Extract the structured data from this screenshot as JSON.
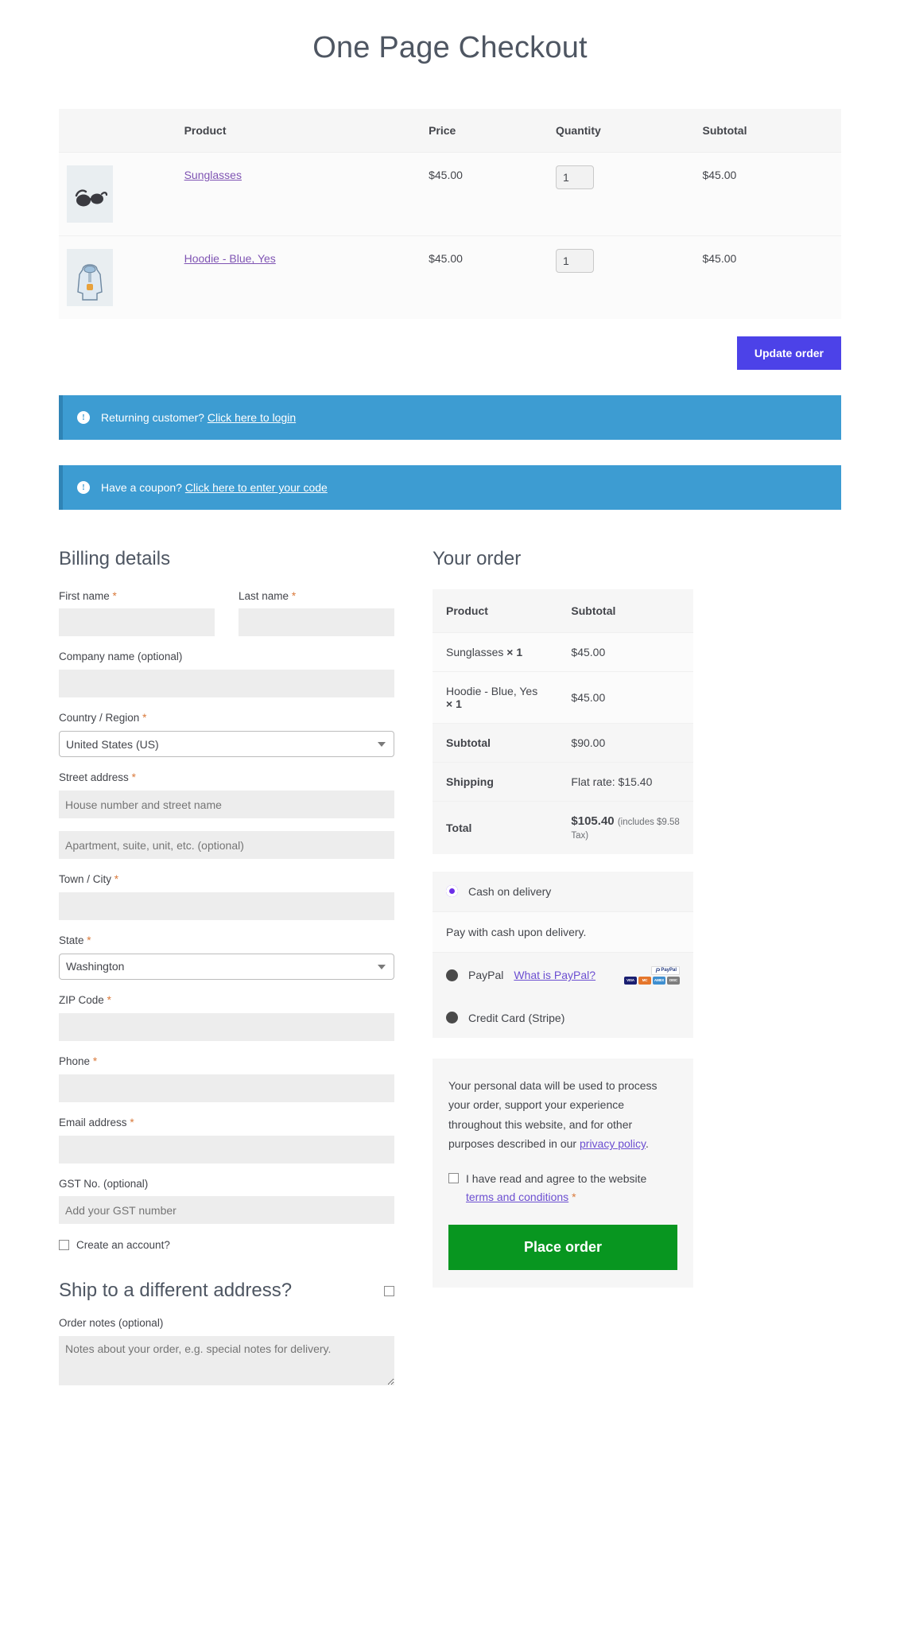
{
  "page": {
    "title": "One Page Checkout"
  },
  "cart": {
    "headers": {
      "thumb": "",
      "product": "Product",
      "price": "Price",
      "quantity": "Quantity",
      "subtotal": "Subtotal"
    },
    "items": [
      {
        "icon": "sunglasses-thumbnail",
        "name": "Sunglasses",
        "price": "$45.00",
        "qty": "1",
        "subtotal": "$45.00"
      },
      {
        "icon": "hoodie-thumbnail",
        "name": "Hoodie - Blue, Yes",
        "price": "$45.00",
        "qty": "1",
        "subtotal": "$45.00"
      }
    ],
    "update_label": "Update order",
    "update_color": "#4c42e8"
  },
  "notices": [
    {
      "icon": "info-icon",
      "glyph": "!",
      "text": "Returning customer?",
      "link": "Click here to login"
    },
    {
      "icon": "info-icon",
      "glyph": "!",
      "text": "Have a coupon?",
      "link": "Click here to enter your code"
    }
  ],
  "notice_color": "#3d9cd2",
  "billing": {
    "title": "Billing details",
    "first_name": {
      "label": "First name",
      "required": "*",
      "value": ""
    },
    "last_name": {
      "label": "Last name",
      "required": "*",
      "value": ""
    },
    "company": {
      "label": "Company name (optional)",
      "value": ""
    },
    "country": {
      "label": "Country / Region",
      "required": "*",
      "value": "United States (US)"
    },
    "street": {
      "label": "Street address",
      "required": "*",
      "placeholder": "House number and street name",
      "value": ""
    },
    "street2": {
      "placeholder": "Apartment, suite, unit, etc. (optional)",
      "value": ""
    },
    "city": {
      "label": "Town / City",
      "required": "*",
      "value": ""
    },
    "state": {
      "label": "State",
      "required": "*",
      "value": "Washington"
    },
    "zip": {
      "label": "ZIP Code",
      "required": "*",
      "value": ""
    },
    "phone": {
      "label": "Phone",
      "required": "*",
      "value": ""
    },
    "email": {
      "label": "Email address",
      "required": "*",
      "value": ""
    },
    "gst": {
      "label": "GST No. (optional)",
      "placeholder": "Add your GST number",
      "value": ""
    },
    "create_account": "Create an account?",
    "ship_different": "Ship to a different address?",
    "order_notes": {
      "label": "Order notes (optional)",
      "placeholder": "Notes about your order, e.g. special notes for delivery.",
      "value": ""
    }
  },
  "order": {
    "title": "Your order",
    "headers": {
      "product": "Product",
      "subtotal": "Subtotal"
    },
    "lines": [
      {
        "name": "Sunglasses",
        "qty": "× 1",
        "amount": "$45.00"
      },
      {
        "name": "Hoodie - Blue, Yes",
        "qty": "× 1",
        "amount": "$45.00"
      }
    ],
    "subtotal": {
      "label": "Subtotal",
      "amount": "$90.00"
    },
    "shipping": {
      "label": "Shipping",
      "amount": "Flat rate: $15.40"
    },
    "total": {
      "label": "Total",
      "amount": "$105.40",
      "tax_note": "(includes $9.58 Tax)"
    }
  },
  "payment": {
    "methods": [
      {
        "id": "cod",
        "label": "Cash on delivery",
        "selected": true,
        "link": "",
        "accent": "#6c2ee8"
      },
      {
        "id": "paypal",
        "label": "PayPal",
        "selected": false,
        "link": "What is PayPal?",
        "accent": "#4a4a4a"
      },
      {
        "id": "stripe",
        "label": "Credit Card (Stripe)",
        "selected": false,
        "link": "",
        "accent": "#4a4a4a"
      }
    ],
    "cod_description": "Pay with cash upon delivery.",
    "paypal_badge": "PayPal",
    "cards": [
      {
        "name": "visa-card-icon",
        "label": "VISA",
        "color": "#1a1f71"
      },
      {
        "name": "mastercard-card-icon",
        "label": "MC",
        "color": "#e5762b"
      },
      {
        "name": "amex-card-icon",
        "label": "AMEX",
        "color": "#3f8fd0"
      },
      {
        "name": "discover-card-icon",
        "label": "DISC",
        "color": "#7e7e7e"
      }
    ]
  },
  "privacy": {
    "text_before": "Your personal data will be used to process your order, support your experience throughout this website, and for other purposes described in our ",
    "link": "privacy policy",
    "text_after": ".",
    "terms_before": "I have read and agree to the website ",
    "terms_link": "terms and conditions",
    "terms_required": "*",
    "place_order": "Place order",
    "place_order_color": "#089620"
  }
}
